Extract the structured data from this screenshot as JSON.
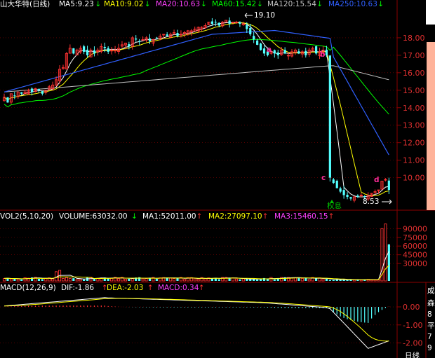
{
  "header": {
    "title": "山大华特(日线)",
    "ma": [
      {
        "text": "MA5:9.23",
        "color": "#ffffff"
      },
      {
        "text": "MA10:9.02",
        "color": "#ffff00"
      },
      {
        "text": "MA20:10.63",
        "color": "#ff40ff"
      },
      {
        "text": "MA60:15.42",
        "color": "#00ff00"
      },
      {
        "text": "MA120:15.54",
        "color": "#c0c0c0"
      },
      {
        "text": "MA250:10.63",
        "color": "#3060ff"
      }
    ]
  },
  "vol_header": {
    "title": "VOL2(5,10,20)",
    "volume": "VOLUME:63032.00",
    "ma": [
      {
        "text": "MA1:52011.00",
        "color": "#ffffff"
      },
      {
        "text": "MA2:27097.10",
        "color": "#ffff00"
      },
      {
        "text": "MA3:15460.15",
        "color": "#ff40ff"
      }
    ]
  },
  "macd_header": {
    "title": "MACD(12,26,9)",
    "items": [
      {
        "text": "DIF:-1.86",
        "color": "#ffffff"
      },
      {
        "text": "DEA:-2.03",
        "color": "#ffff00"
      },
      {
        "text": "MACD:0.34",
        "color": "#ff40ff"
      }
    ]
  },
  "annotations": {
    "a": "a",
    "b": "b",
    "c": "c",
    "d": "d",
    "high_label": "19.10",
    "low_label": "8.53",
    "rights_label": "权息"
  },
  "right_panel": {
    "chars": [
      "成",
      "森",
      "8",
      "平",
      "7",
      "9",
      "2"
    ]
  },
  "bottom_label": "日线",
  "chart_data": [
    {
      "type": "candlestick",
      "title": "山大华特(日线)",
      "y_ticks": [
        10,
        11,
        12,
        13,
        14,
        15,
        16,
        17,
        18
      ],
      "y_tick_labels": [
        "10.00",
        "11.00",
        "12.00",
        "13.00",
        "14.00",
        "15.00",
        "16.00",
        "17.00",
        "18.00"
      ],
      "ylim": [
        8.3,
        19.6
      ],
      "n_bars": 112,
      "close": [
        14.6,
        14.3,
        14.8,
        14.7,
        14.9,
        14.8,
        14.9,
        15.0,
        14.9,
        15.1,
        15.0,
        14.8,
        15.0,
        15.2,
        15.3,
        15.6,
        16.2,
        16.3,
        17.1,
        17.4,
        17.1,
        17.3,
        17.4,
        17.2,
        17.0,
        17.3,
        17.1,
        17.3,
        17.5,
        17.4,
        17.2,
        17.3,
        17.3,
        17.4,
        17.6,
        17.7,
        17.5,
        18.0,
        17.9,
        17.8,
        17.9,
        18.0,
        17.8,
        17.9,
        18.0,
        18.1,
        18.2,
        18.1,
        18.2,
        18.3,
        18.1,
        18.2,
        18.3,
        18.4,
        18.4,
        18.5,
        18.6,
        18.6,
        18.7,
        18.9,
        18.8,
        18.9,
        18.7,
        18.9,
        19.0,
        18.8,
        18.9,
        18.9,
        18.8,
        18.8,
        18.5,
        18.2,
        17.9,
        17.6,
        17.3,
        17.1,
        17.0,
        17.2,
        17.1,
        17.0,
        17.3,
        17.1,
        17.0,
        17.2,
        17.3,
        17.1,
        17.2,
        17.0,
        17.3,
        17.4,
        17.1,
        17.2,
        17.3,
        17.0,
        10.0,
        9.7,
        9.4,
        9.2,
        9.0,
        8.9,
        8.8,
        8.9,
        8.9,
        9.0,
        8.9,
        9.0,
        9.1,
        9.2,
        9.3,
        9.8,
        9.9,
        9.3
      ],
      "series": [
        {
          "name": "MA5",
          "color": "#ffffff"
        },
        {
          "name": "MA10",
          "color": "#ffff00"
        },
        {
          "name": "MA60",
          "color": "#00ff00"
        },
        {
          "name": "MA120",
          "color": "#c0c0c0"
        },
        {
          "name": "MA250",
          "color": "#3060ff"
        }
      ],
      "annotations": [
        {
          "label": "19.10",
          "value": 19.1,
          "kind": "high"
        },
        {
          "label": "8.53",
          "value": 8.53,
          "kind": "low"
        }
      ]
    },
    {
      "type": "bar",
      "title": "VOL2(5,10,20)",
      "y_ticks": [
        30000,
        45000,
        60000,
        75000,
        90000
      ],
      "y_tick_labels": [
        "30000",
        "45000",
        "60000",
        "75000",
        "90000"
      ],
      "ylim": [
        0,
        100000
      ],
      "volume_last": 63032,
      "volume_recent": [
        90000,
        98000,
        63032
      ]
    },
    {
      "type": "bar",
      "title": "MACD(12,26,9)",
      "y_ticks": [
        0,
        -1,
        -2
      ],
      "y_tick_labels": [
        "0.00",
        "-1.00",
        "-2.00"
      ],
      "ylim": [
        -2.6,
        0.7
      ],
      "DIF": -1.86,
      "DEA": -2.03,
      "MACD": 0.34
    }
  ],
  "colors": {
    "up": "#ff3232",
    "down": "#54ffff",
    "grid": "#8b0000",
    "axis_text": "#e03030",
    "annot": "#ff2d9a"
  }
}
